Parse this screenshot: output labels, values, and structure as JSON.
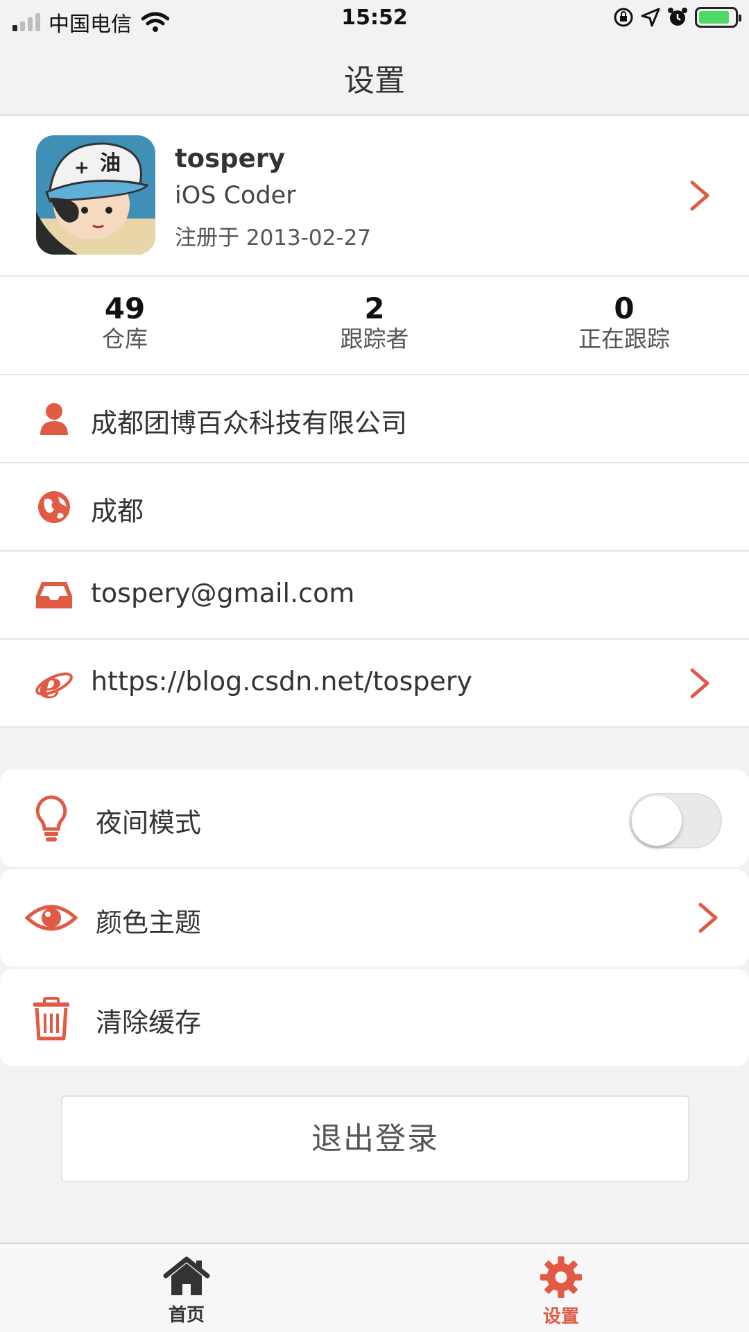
{
  "status_bar": {
    "carrier": "中国电信",
    "time": "15:52"
  },
  "nav": {
    "title": "设置"
  },
  "profile": {
    "name": "tospery",
    "bio": "iOS Coder",
    "registered": "注册于 2013-02-27"
  },
  "stats": [
    {
      "value": "49",
      "label": "仓库"
    },
    {
      "value": "2",
      "label": "跟踪者"
    },
    {
      "value": "0",
      "label": "正在跟踪"
    }
  ],
  "info": {
    "company": "成都团博百众科技有限公司",
    "location": "成都",
    "email": "tospery@gmail.com",
    "blog": "https://blog.csdn.net/tospery"
  },
  "settings": {
    "night_mode_label": "夜间模式",
    "night_mode_on": false,
    "theme_label": "颜色主题",
    "clear_cache_label": "清除缓存"
  },
  "logout_label": "退出登录",
  "tabbar": {
    "home_label": "首页",
    "settings_label": "设置"
  },
  "colors": {
    "accent": "#e05a44",
    "background": "#f2f2f2",
    "card": "#ffffff",
    "text": "#333333"
  },
  "icons": [
    "user-icon",
    "globe-icon",
    "inbox-icon",
    "ie-browser-icon",
    "lightbulb-icon",
    "eye-icon",
    "trash-icon",
    "home-icon",
    "gear-icon",
    "chevron-right-icon"
  ]
}
